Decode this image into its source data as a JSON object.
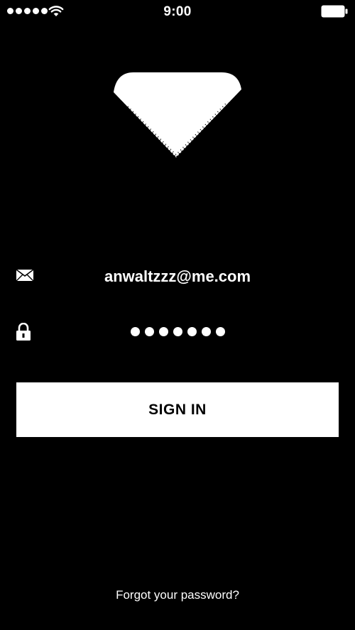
{
  "status_bar": {
    "time": "9:00",
    "icons": [
      "signal-dots-icon",
      "wifi-icon",
      "battery-icon"
    ]
  },
  "login": {
    "email_value": "anwaltzzz@me.com",
    "password_mask": "●●●●●●●",
    "password_length": 7,
    "sign_in_label": "SIGN IN",
    "forgot_label": "Forgot your password?",
    "icons": [
      "diamond-logo-icon",
      "mail-icon",
      "lock-icon"
    ]
  },
  "colors": {
    "background": "#000000",
    "foreground": "#ffffff",
    "button_text": "#000000"
  }
}
